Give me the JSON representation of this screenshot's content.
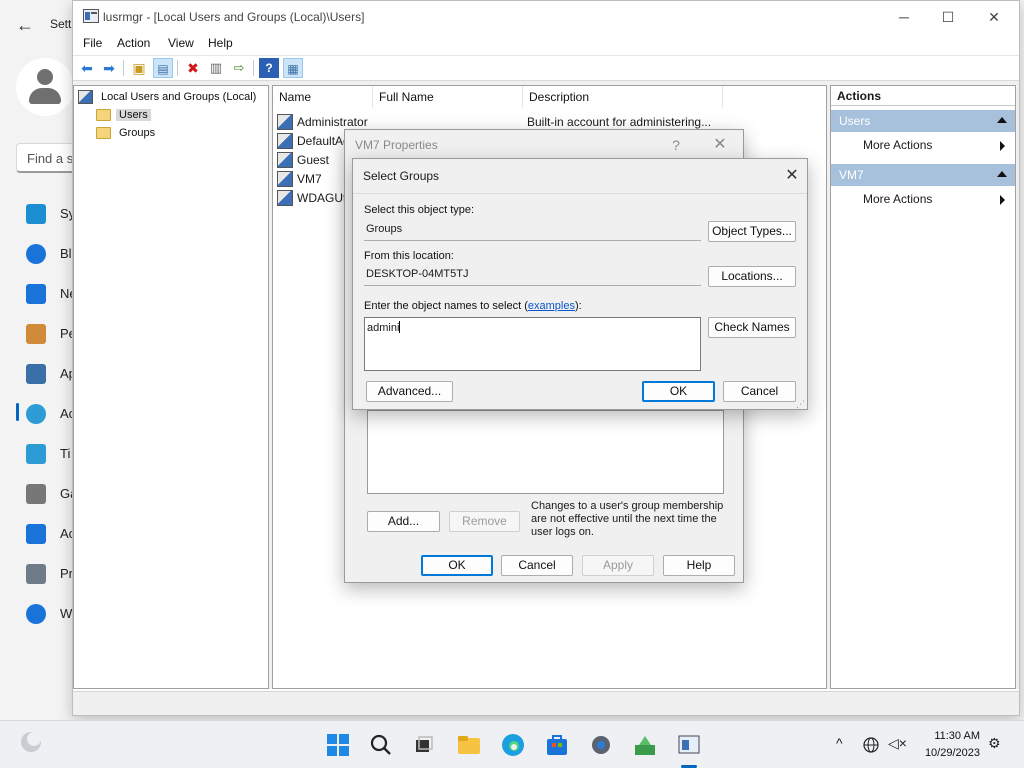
{
  "settings": {
    "title": "Sett",
    "search_placeholder": "Find a s",
    "nav": [
      {
        "label": "Sy",
        "icon": "system-icon",
        "color": "#1b8fd1"
      },
      {
        "label": "Bl",
        "icon": "bluetooth-icon",
        "color": "#1a73d9"
      },
      {
        "label": "Ne",
        "icon": "network-icon",
        "color": "#1a73d9"
      },
      {
        "label": "Pe",
        "icon": "personalization-icon",
        "color": "#d08a3a"
      },
      {
        "label": "Ap",
        "icon": "apps-icon",
        "color": "#3a6fa8"
      },
      {
        "label": "Ac",
        "icon": "accounts-icon",
        "color": "#2d9bd6"
      },
      {
        "label": "Ti",
        "icon": "time-language-icon",
        "color": "#2d9bd6"
      },
      {
        "label": "Ga",
        "icon": "gaming-icon",
        "color": "#777777"
      },
      {
        "label": "Ac",
        "icon": "accessibility-icon",
        "color": "#1a73d9"
      },
      {
        "label": "Pr",
        "icon": "privacy-shield-icon",
        "color": "#6f7b88"
      },
      {
        "label": "W",
        "icon": "windows-update-icon",
        "color": "#1a73d9"
      }
    ]
  },
  "mmc": {
    "title": "lusrmgr - [Local Users and Groups (Local)\\Users]",
    "menu": [
      "File",
      "Action",
      "View",
      "Help"
    ],
    "tree": {
      "root": "Local Users and Groups (Local)",
      "children": [
        "Users",
        "Groups"
      ]
    },
    "columns": [
      "Name",
      "Full Name",
      "Description"
    ],
    "users": [
      {
        "name": "Administrator",
        "description": "Built-in account for administering..."
      },
      {
        "name": "DefaultAc",
        "description": ""
      },
      {
        "name": "Guest",
        "description": ""
      },
      {
        "name": "VM7",
        "description": ""
      },
      {
        "name": "WDAGUti",
        "description": ""
      }
    ],
    "actions": {
      "header": "Actions",
      "groups": [
        {
          "name": "Users",
          "item": "More Actions"
        },
        {
          "name": "VM7",
          "item": "More Actions"
        }
      ]
    }
  },
  "properties_dialog": {
    "title": "VM7 Properties",
    "help_glyph": "?",
    "note": "Changes to a user's group membership are not effective until the next time the user logs on.",
    "buttons": {
      "add": "Add...",
      "remove": "Remove",
      "ok": "OK",
      "cancel": "Cancel",
      "apply": "Apply",
      "help": "Help"
    }
  },
  "select_groups": {
    "title": "Select Groups",
    "object_type_label": "Select this object type:",
    "object_type_value": "Groups",
    "object_types_button": "Object Types...",
    "location_label": "From this location:",
    "location_value": "DESKTOP-04MT5TJ",
    "locations_button": "Locations...",
    "names_label_prefix": "Enter the object names to select (",
    "names_label_link": "examples",
    "names_label_suffix": "):",
    "names_value": "admini",
    "check_names_button": "Check Names",
    "advanced_button": "Advanced...",
    "ok_button": "OK",
    "cancel_button": "Cancel"
  },
  "taskbar": {
    "time": "11:30 AM",
    "date": "10/29/2023"
  }
}
